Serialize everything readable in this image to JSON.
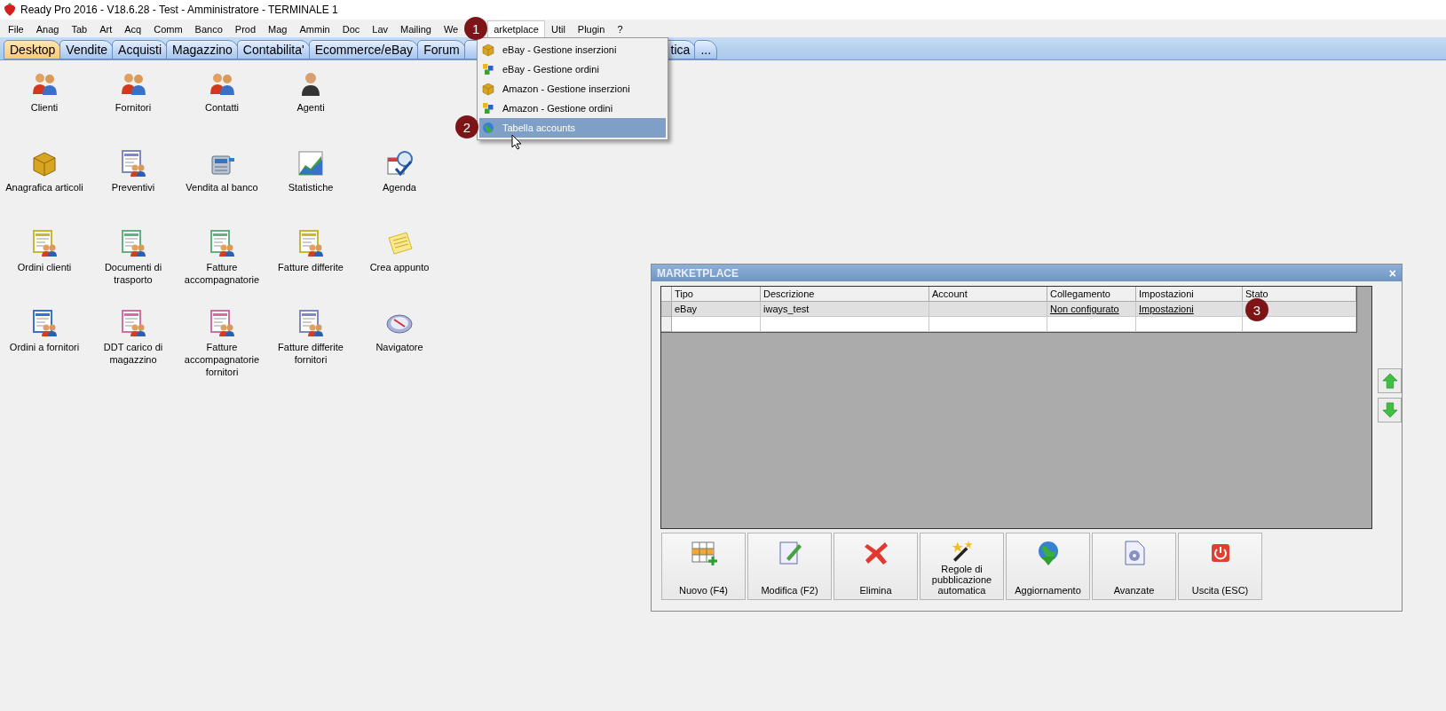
{
  "window": {
    "title": "Ready Pro 2016 - V18.6.28 - Test - Amministratore - TERMINALE 1"
  },
  "menu": [
    {
      "label": "File",
      "selected": false
    },
    {
      "label": "Anag",
      "selected": false
    },
    {
      "label": "Tab",
      "selected": false
    },
    {
      "label": "Art",
      "selected": false
    },
    {
      "label": "Acq",
      "selected": false
    },
    {
      "label": "Comm",
      "selected": false
    },
    {
      "label": "Banco",
      "selected": false
    },
    {
      "label": "Prod",
      "selected": false
    },
    {
      "label": "Mag",
      "selected": false
    },
    {
      "label": "Ammin",
      "selected": false
    },
    {
      "label": "Doc",
      "selected": false
    },
    {
      "label": "Lav",
      "selected": false
    },
    {
      "label": "Mailing",
      "selected": false
    },
    {
      "label": "We",
      "selected": false
    },
    {
      "label": "arketplace",
      "selected": true
    },
    {
      "label": "Util",
      "selected": false
    },
    {
      "label": "Plugin",
      "selected": false
    },
    {
      "label": "?",
      "selected": false
    }
  ],
  "tabs": [
    {
      "label": "Desktop",
      "selected": true
    },
    {
      "label": "Vendite",
      "selected": false
    },
    {
      "label": "Acquisti",
      "selected": false
    },
    {
      "label": "Magazzino",
      "selected": false
    },
    {
      "label": "Contabilita'",
      "selected": false
    },
    {
      "label": "Ecommerce/eBay",
      "selected": false
    },
    {
      "label": "Forum",
      "selected": false
    },
    {
      "label": "tica",
      "selected": false
    },
    {
      "label": "...",
      "selected": false
    }
  ],
  "dropdown": {
    "items": [
      {
        "label": "eBay - Gestione inserzioni",
        "kind": "box",
        "selected": false
      },
      {
        "label": "eBay - Gestione ordini",
        "kind": "cubes",
        "selected": false
      },
      {
        "label": "Amazon - Gestione inserzioni",
        "kind": "box",
        "selected": false
      },
      {
        "label": "Amazon - Gestione ordini",
        "kind": "cubes",
        "selected": false
      },
      {
        "label": "Tabella accounts",
        "kind": "globe",
        "selected": true
      }
    ]
  },
  "desktop": {
    "rows": [
      [
        {
          "label": "Clienti",
          "kind": "people"
        },
        {
          "label": "Fornitori",
          "kind": "people"
        },
        {
          "label": "Contatti",
          "kind": "people"
        },
        {
          "label": "Agenti",
          "kind": "person"
        }
      ],
      [
        {
          "label": "Anagrafica articoli",
          "kind": "box"
        },
        {
          "label": "Preventivi",
          "kind": "doc-violet"
        },
        {
          "label": "Vendita al banco",
          "kind": "register"
        },
        {
          "label": "Statistiche",
          "kind": "chart"
        },
        {
          "label": "Agenda",
          "kind": "calendar"
        }
      ],
      [
        {
          "label": "Ordini clienti",
          "kind": "doc-yellow"
        },
        {
          "label": "Documenti di trasporto",
          "kind": "doc-green"
        },
        {
          "label": "Fatture accompagnatorie",
          "kind": "doc-green"
        },
        {
          "label": "Fatture differite",
          "kind": "doc-yellow"
        },
        {
          "label": "Crea appunto",
          "kind": "note"
        }
      ],
      [
        {
          "label": "Ordini a fornitori",
          "kind": "doc-blue"
        },
        {
          "label": "DDT carico di magazzino",
          "kind": "doc-pink"
        },
        {
          "label": "Fatture accompagnatorie fornitori",
          "kind": "doc-pink"
        },
        {
          "label": "Fatture differite fornitori",
          "kind": "doc-violet"
        },
        {
          "label": "Navigatore",
          "kind": "compass"
        }
      ]
    ]
  },
  "dialog": {
    "title": "MARKETPLACE",
    "close": "×",
    "table": {
      "columns": [
        "Tipo",
        "Descrizione",
        "Account",
        "Collegamento",
        "Impostazioni",
        "Stato"
      ],
      "rows": [
        {
          "cells": [
            {
              "text": "eBay",
              "link": false
            },
            {
              "text": "iways_test",
              "link": false
            },
            null,
            {
              "text": "Non configurato",
              "link": true
            },
            {
              "text": "Impostazioni",
              "link": true
            },
            null
          ],
          "selected": true
        }
      ]
    },
    "buttons": [
      {
        "label": "Nuovo (F4)",
        "kind": "grid-add"
      },
      {
        "label": "Modifica (F2)",
        "kind": "edit"
      },
      {
        "label": "Elimina",
        "kind": "cross"
      },
      {
        "label": "Regole di pubblicazione automatica",
        "kind": "wand"
      },
      {
        "label": "Aggiornamento",
        "kind": "globe-down"
      },
      {
        "label": "Avanzate",
        "kind": "gear-doc"
      },
      {
        "label": "Uscita (ESC)",
        "kind": "power"
      }
    ]
  },
  "markers": [
    "1",
    "2",
    "3"
  ]
}
